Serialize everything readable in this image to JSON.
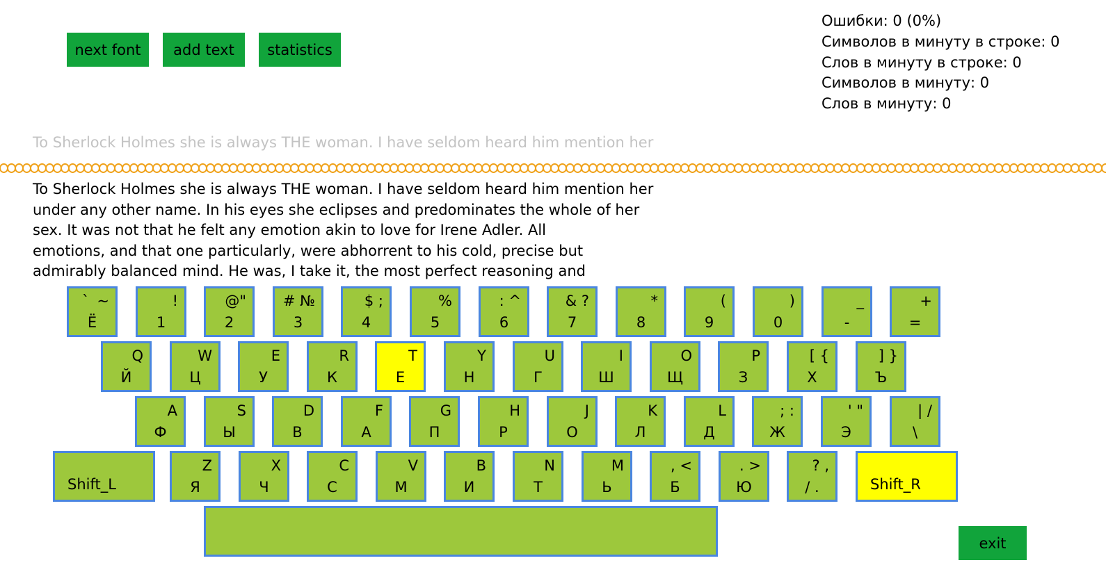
{
  "toolbar": {
    "next_font": "next font",
    "add_text": "add text",
    "statistics": "statistics"
  },
  "stats": {
    "errors": "Ошибки: 0 (0%)",
    "chars_per_min_line": "Символов в минуту в строке: 0",
    "words_per_min_line": "Слов в минуту в строке: 0",
    "chars_per_min": "Символов в минуту: 0",
    "words_per_min": "Слов в минуту: 0"
  },
  "typing_preview": "To Sherlock Holmes she is always THE woman. I have seldom heard him mention her",
  "text_lines": [
    "To Sherlock Holmes she is always THE woman. I have seldom heard him mention her",
    "under any other name. In his eyes she eclipses and predominates the whole of her",
    "sex. It was not that he felt any emotion akin to love for Irene Adler. All",
    "emotions, and that one particularly, were abhorrent to his cold, precise but",
    "admirably balanced mind. He was, I take it, the most perfect reasoning and"
  ],
  "keyboard": {
    "row1": [
      {
        "tl": "`",
        "tr": "~",
        "b": "Ё"
      },
      {
        "tl": "",
        "tr": "!",
        "b": "1"
      },
      {
        "tl": "",
        "tr": "@\"",
        "b": "2"
      },
      {
        "tl": "",
        "tr": "# №",
        "b": "3"
      },
      {
        "tl": "",
        "tr": "$ ;",
        "b": "4"
      },
      {
        "tl": "",
        "tr": "%",
        "b": "5"
      },
      {
        "tl": "",
        "tr": ": ^",
        "b": "6"
      },
      {
        "tl": "",
        "tr": "& ?",
        "b": "7"
      },
      {
        "tl": "",
        "tr": "*",
        "b": "8"
      },
      {
        "tl": "",
        "tr": "(",
        "b": "9"
      },
      {
        "tl": "",
        "tr": ")",
        "b": "0"
      },
      {
        "tl": "",
        "tr": "_",
        "b": "-"
      },
      {
        "tl": "",
        "tr": "+",
        "b": "="
      }
    ],
    "row2": [
      {
        "tr": "Q",
        "b": "Й"
      },
      {
        "tr": "W",
        "b": "Ц"
      },
      {
        "tr": "E",
        "b": "У"
      },
      {
        "tr": "R",
        "b": "К"
      },
      {
        "tr": "T",
        "b": "Е",
        "active": true
      },
      {
        "tr": "Y",
        "b": "Н"
      },
      {
        "tr": "U",
        "b": "Г"
      },
      {
        "tr": "I",
        "b": "Ш"
      },
      {
        "tr": "O",
        "b": "Щ"
      },
      {
        "tr": "P",
        "b": "З"
      },
      {
        "tr": "[ {",
        "b": "Х"
      },
      {
        "tr": "] }",
        "b": "Ъ"
      }
    ],
    "row3": [
      {
        "tr": "A",
        "b": "Ф"
      },
      {
        "tr": "S",
        "b": "Ы"
      },
      {
        "tr": "D",
        "b": "В"
      },
      {
        "tr": "F",
        "b": "А"
      },
      {
        "tr": "G",
        "b": "П"
      },
      {
        "tr": "H",
        "b": "Р"
      },
      {
        "tr": "J",
        "b": "О"
      },
      {
        "tr": "K",
        "b": "Л"
      },
      {
        "tr": "L",
        "b": "Д"
      },
      {
        "tr": "; :",
        "b": "Ж"
      },
      {
        "tr": "' \"",
        "b": "Э"
      },
      {
        "tr": "| /",
        "b": "\\"
      }
    ],
    "row4": [
      {
        "tr": "Z",
        "b": "Я"
      },
      {
        "tr": "X",
        "b": "Ч"
      },
      {
        "tr": "C",
        "b": "С"
      },
      {
        "tr": "V",
        "b": "М"
      },
      {
        "tr": "B",
        "b": "И"
      },
      {
        "tr": "N",
        "b": "Т"
      },
      {
        "tr": "M",
        "b": "Ь"
      },
      {
        "tr": ", <",
        "b": "Б"
      },
      {
        "tr": ". >",
        "b": "Ю"
      },
      {
        "tr": "? ,",
        "b": "/ ."
      }
    ],
    "shift_left": "Shift_L",
    "shift_right": "Shift_R",
    "shift_right_active": true
  },
  "exit_label": "exit",
  "colors": {
    "button_green": "#11a43b",
    "key_green": "#9dc83c",
    "key_border": "#4a86e0",
    "highlight": "#ffff00",
    "chain": "#f0a21a"
  }
}
